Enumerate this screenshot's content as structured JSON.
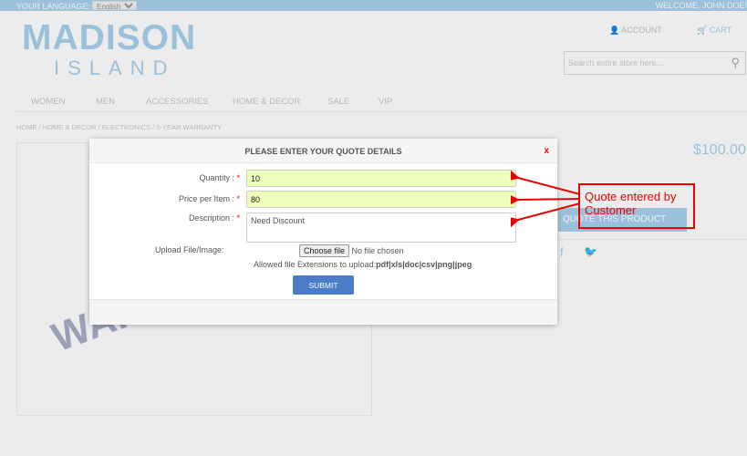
{
  "topbar": {
    "language_label": "YOUR LANGUAGE:",
    "language_value": "English",
    "welcome": "WELCOME, JOHN DOE!"
  },
  "logo": {
    "line1": "MADISON",
    "line2": "ISLAND"
  },
  "header": {
    "account": "ACCOUNT",
    "cart": "CART",
    "search_placeholder": "Search entire store here..."
  },
  "nav": [
    "WOMEN",
    "MEN",
    "ACCESSORIES",
    "HOME & DECOR",
    "SALE",
    "VIP"
  ],
  "breadcrumb": "HOME / HOME & DECOR / ELECTRONICS / 5-YEAR WARRANTY",
  "product": {
    "price": "$100.00",
    "quote_button": "QUOTE THIS PRODUCT",
    "watermark": "WARRANTY"
  },
  "modal": {
    "title": "PLEASE ENTER YOUR QUOTE DETAILS",
    "close": "x",
    "quantity_label": "Quantity :",
    "quantity": "10",
    "price_label": "Price per Item :",
    "price": "80",
    "description_label": "Description :",
    "description": "Need Discount",
    "required": "*",
    "upload_label": "Upload File/Image:",
    "choose_file": "Choose file",
    "no_file": "No file chosen",
    "allowed_prefix": "Allowed file Extensions to upload:",
    "allowed_ext": "pdf|xls|doc|csv|png|jpeg",
    "submit": "SUBMIT"
  },
  "annotation": "Quote entered by Customer"
}
